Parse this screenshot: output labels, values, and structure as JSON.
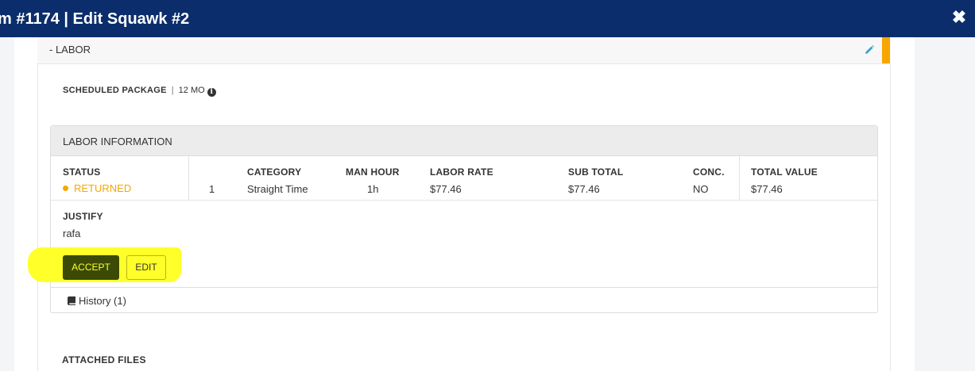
{
  "modal": {
    "title": "m #1174 | Edit Squawk #2",
    "close_icon": "close-icon"
  },
  "labor_section": {
    "header": "- LABOR",
    "edit_icon": "pencil-icon",
    "accent_color": "#f7a600",
    "scheduled_package_label": "SCHEDULED PACKAGE",
    "separator": "|",
    "scheduled_package_value": "12 MO",
    "info_icon": "info-icon"
  },
  "labor_information": {
    "title": "LABOR INFORMATION",
    "columns": {
      "status": "STATUS",
      "category": "CATEGORY",
      "man_hour": "MAN HOUR",
      "labor_rate": "LABOR RATE",
      "sub_total": "SUB TOTAL",
      "conc": "CONC.",
      "total_value": "TOTAL VALUE"
    },
    "row": {
      "status": "RETURNED",
      "status_color": "#f7a600",
      "index": "1",
      "category": "Straight Time",
      "man_hour": "1h",
      "labor_rate": "$77.46",
      "sub_total": "$77.46",
      "conc": "NO",
      "total_value": "$77.46"
    },
    "justify_label": "JUSTIFY",
    "justify_value": "rafa",
    "accept_label": "ACCEPT",
    "edit_label": "EDIT",
    "history_label": "History (1)",
    "history_icon": "book-icon"
  },
  "attached_files_label": "ATTACHED FILES"
}
